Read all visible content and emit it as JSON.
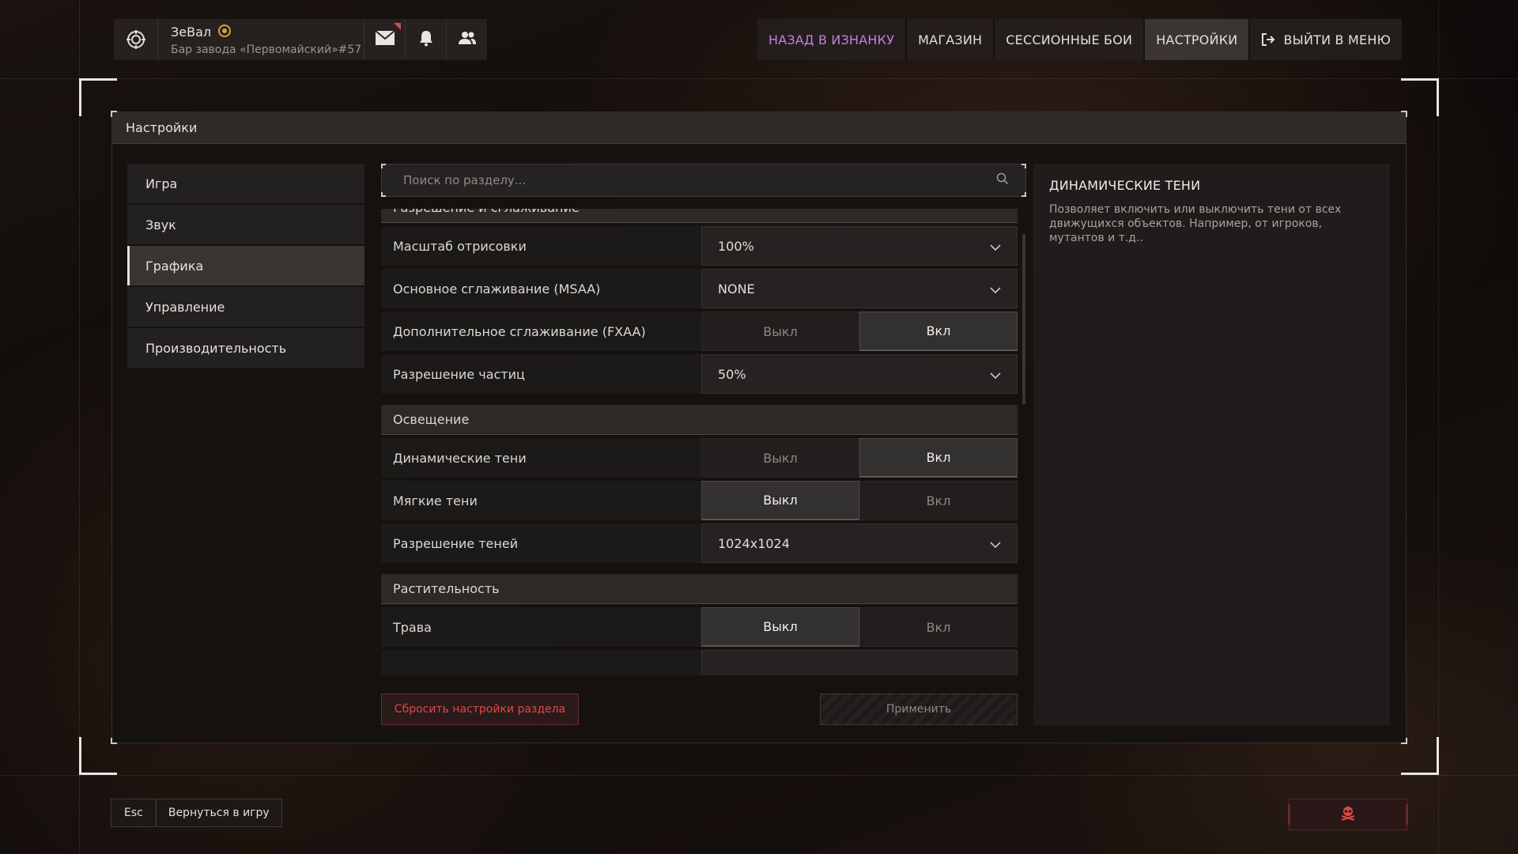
{
  "user": {
    "name": "ЗеВал",
    "location": "Бар завода «Первомайский»#57"
  },
  "topnav": {
    "back": "НАЗАД В ИЗНАНКУ",
    "shop": "МАГАЗИН",
    "sessions": "СЕССИОННЫЕ БОИ",
    "settings": "НАСТРОЙКИ",
    "exit": "ВЫЙТИ В МЕНЮ"
  },
  "panel": {
    "title": "Настройки"
  },
  "sidebar": {
    "items": [
      {
        "label": "Игра"
      },
      {
        "label": "Звук"
      },
      {
        "label": "Графика"
      },
      {
        "label": "Управление"
      },
      {
        "label": "Производительность"
      }
    ]
  },
  "search": {
    "placeholder": "Поиск по разделу..."
  },
  "settings": {
    "section_resolution": "Разрешение и сглаживание",
    "render_scale_label": "Масштаб отрисовки",
    "render_scale_value": "100%",
    "msaa_label": "Основное сглаживание (MSAA)",
    "msaa_value": "NONE",
    "fxaa_label": "Дополнительное сглаживание (FXAA)",
    "particles_label": "Разрешение частиц",
    "particles_value": "50%",
    "section_lighting": "Освещение",
    "dyn_shadows_label": "Динамические тени",
    "soft_shadows_label": "Мягкие тени",
    "shadow_res_label": "Разрешение теней",
    "shadow_res_value": "1024x1024",
    "section_vegetation": "Растительность",
    "grass_label": "Трава",
    "off": "Выкл",
    "on": "Вкл"
  },
  "buttons": {
    "reset": "Сбросить настройки раздела",
    "apply": "Применить"
  },
  "description": {
    "title": "ДИНАМИЧЕСКИЕ ТЕНИ",
    "text": "Позволяет включить или выключить тени от всех движущихся объектов. Например, от игроков, мутантов и т.д.."
  },
  "footer": {
    "esc_key": "Esc",
    "return_label": "Вернуться в игру"
  },
  "colors": {
    "accent_purple": "#c57ee6",
    "danger_red": "#e04848"
  }
}
